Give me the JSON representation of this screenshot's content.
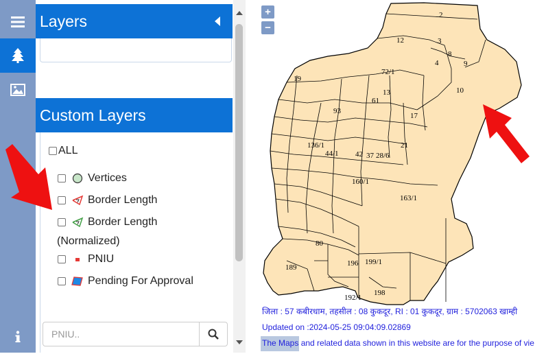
{
  "sidebar": {
    "icons": [
      "menu-icon",
      "tree-icon",
      "image-icon",
      "info-icon"
    ],
    "accent": "#0d72d6",
    "rail_color": "#7e9ac6"
  },
  "panel": {
    "layers_title": "Layers",
    "custom_layers_title": "Custom Layers",
    "all_label": "ALL",
    "items": [
      {
        "label": "Vertices",
        "icon": "vertices-icon"
      },
      {
        "label": "Border Length",
        "icon": "border-length-icon"
      },
      {
        "label": "Border Length",
        "icon": "border-length-normalized-icon"
      },
      {
        "label": "PNIU",
        "icon": "pniu-icon"
      },
      {
        "label": "Pending For Approval",
        "icon": "pending-approval-icon"
      }
    ],
    "normalized_suffix": "(Normalized)",
    "search_placeholder": "PNIU.."
  },
  "map": {
    "zoom_in": "+",
    "zoom_out": "−",
    "parcel_fill": "#fde4b8",
    "plot_labels": [
      "2",
      "3",
      "4",
      "8",
      "9",
      "10",
      "12",
      "72/1",
      "13",
      "61",
      "17",
      "21",
      "136/1",
      "44/1",
      "42",
      "37",
      "28/6",
      "160/1",
      "163/1",
      "80",
      "189",
      "196",
      "199/1",
      "192/1",
      "198",
      "93",
      "19"
    ],
    "info_line1": "जिला : 57 कबीरधाम, तहसील : 08 कुकदूर, RI : 01 कुकदूर, ग्राम : 5702063 खाम्ही",
    "info_line2": "Updated on :2024-05-25 09:04:09.02869",
    "disclaimer": "The Maps and related data shown in this website are for the purpose of vie"
  }
}
